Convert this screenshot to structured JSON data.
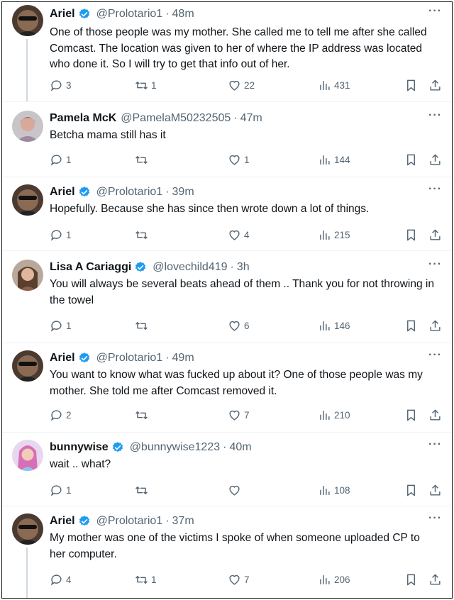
{
  "tweets": [
    {
      "name": "Ariel",
      "verified": true,
      "handle": "@Prolotario1",
      "time": "48m",
      "text": "One of those people was my mother. She called me to tell me after she called Comcast. The location was given to her of where the IP address was located who done it. So I will try to get that info out of her.",
      "replies": "3",
      "retweets": "1",
      "likes": "22",
      "views": "431",
      "avatar": "ariel"
    },
    {
      "name": "Pamela McK",
      "verified": false,
      "handle": "@PamelaM50232505",
      "time": "47m",
      "text": "Betcha mama still has it",
      "replies": "1",
      "retweets": "",
      "likes": "1",
      "views": "144",
      "avatar": "pamela"
    },
    {
      "name": "Ariel",
      "verified": true,
      "handle": "@Prolotario1",
      "time": "39m",
      "text": "Hopefully. Because she has since then wrote down a lot of things.",
      "replies": "1",
      "retweets": "",
      "likes": "4",
      "views": "215",
      "avatar": "ariel"
    },
    {
      "name": "Lisa A Cariaggi",
      "verified": true,
      "handle": "@lovechild419",
      "time": "3h",
      "text": "You will always be several beats ahead of them .. Thank you for not throwing in the towel",
      "replies": "1",
      "retweets": "",
      "likes": "6",
      "views": "146",
      "avatar": "lisa"
    },
    {
      "name": "Ariel",
      "verified": true,
      "handle": "@Prolotario1",
      "time": "49m",
      "text": "You want to know what was fucked up about it? One of those people was my mother. She told me after Comcast removed it.",
      "replies": "2",
      "retweets": "",
      "likes": "7",
      "views": "210",
      "avatar": "ariel"
    },
    {
      "name": "bunnywise",
      "verified": true,
      "handle": "@bunnywise1223",
      "time": "40m",
      "text": "wait .. what?",
      "replies": "1",
      "retweets": "",
      "likes": "",
      "views": "108",
      "avatar": "bunny"
    },
    {
      "name": "Ariel",
      "verified": true,
      "handle": "@Prolotario1",
      "time": "37m",
      "text": "My mother was one of the victims I spoke of when someone uploaded CP to her computer.",
      "replies": "4",
      "retweets": "1",
      "likes": "7",
      "views": "206",
      "avatar": "ariel"
    }
  ],
  "colors": {
    "verified": "#1d9bf0",
    "muted": "#536471",
    "text": "#0f1419",
    "thread_line": "#cfd9de"
  },
  "icons": [
    "verified-badge-icon",
    "more-icon",
    "reply-icon",
    "retweet-icon",
    "like-icon",
    "views-icon",
    "bookmark-icon",
    "share-icon"
  ]
}
